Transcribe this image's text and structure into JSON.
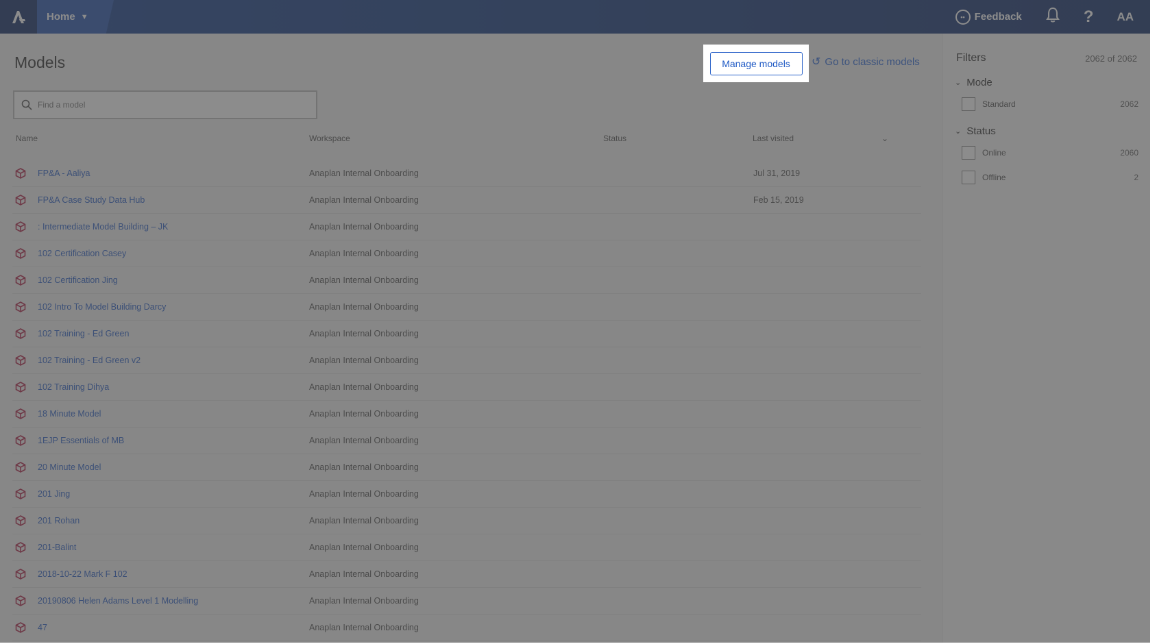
{
  "topbar": {
    "home_label": "Home",
    "feedback_label": "Feedback",
    "help_label": "?",
    "avatar_initials": "AA"
  },
  "page": {
    "title": "Models",
    "manage_models_label": "Manage models",
    "classic_link_label": "Go to classic models",
    "search_placeholder": "Find a model"
  },
  "table": {
    "columns": [
      "Name",
      "Workspace",
      "Status",
      "Last visited"
    ],
    "rows": [
      {
        "name": "FP&A - Aaliya",
        "workspace": "Anaplan Internal Onboarding",
        "last_visited": "Jul 31, 2019"
      },
      {
        "name": "FP&A Case Study Data Hub",
        "workspace": "Anaplan Internal Onboarding",
        "last_visited": "Feb 15, 2019"
      },
      {
        "name": ": Intermediate Model Building – JK",
        "workspace": "Anaplan Internal Onboarding",
        "last_visited": ""
      },
      {
        "name": "102 Certification Casey",
        "workspace": "Anaplan Internal Onboarding",
        "last_visited": ""
      },
      {
        "name": "102 Certification Jing",
        "workspace": "Anaplan Internal Onboarding",
        "last_visited": ""
      },
      {
        "name": "102 Intro To Model Building Darcy",
        "workspace": "Anaplan Internal Onboarding",
        "last_visited": ""
      },
      {
        "name": "102 Training - Ed Green",
        "workspace": "Anaplan Internal Onboarding",
        "last_visited": ""
      },
      {
        "name": "102 Training - Ed Green v2",
        "workspace": "Anaplan Internal Onboarding",
        "last_visited": ""
      },
      {
        "name": "102 Training Dihya",
        "workspace": "Anaplan Internal Onboarding",
        "last_visited": ""
      },
      {
        "name": "18 Minute Model",
        "workspace": "Anaplan Internal Onboarding",
        "last_visited": ""
      },
      {
        "name": "1EJP Essentials of MB",
        "workspace": "Anaplan Internal Onboarding",
        "last_visited": ""
      },
      {
        "name": "20 Minute Model",
        "workspace": "Anaplan Internal Onboarding",
        "last_visited": ""
      },
      {
        "name": "201 Jing",
        "workspace": "Anaplan Internal Onboarding",
        "last_visited": ""
      },
      {
        "name": "201 Rohan",
        "workspace": "Anaplan Internal Onboarding",
        "last_visited": ""
      },
      {
        "name": "201-Balint",
        "workspace": "Anaplan Internal Onboarding",
        "last_visited": ""
      },
      {
        "name": "2018-10-22 Mark F 102",
        "workspace": "Anaplan Internal Onboarding",
        "last_visited": ""
      },
      {
        "name": "20190806 Helen Adams Level 1 Modelling",
        "workspace": "Anaplan Internal Onboarding",
        "last_visited": ""
      },
      {
        "name": "47",
        "workspace": "Anaplan Internal Onboarding",
        "last_visited": ""
      }
    ]
  },
  "filters": {
    "title": "Filters",
    "count": "2062 of 2062",
    "groups": [
      {
        "label": "Mode",
        "options": [
          {
            "label": "Standard",
            "count": "2062"
          }
        ]
      },
      {
        "label": "Status",
        "options": [
          {
            "label": "Online",
            "count": "2060"
          },
          {
            "label": "Offline",
            "count": "2"
          }
        ]
      }
    ]
  },
  "colors": {
    "topbar": "#1a3f84",
    "link": "#2f62c8",
    "model_icon": "#b0264a"
  }
}
